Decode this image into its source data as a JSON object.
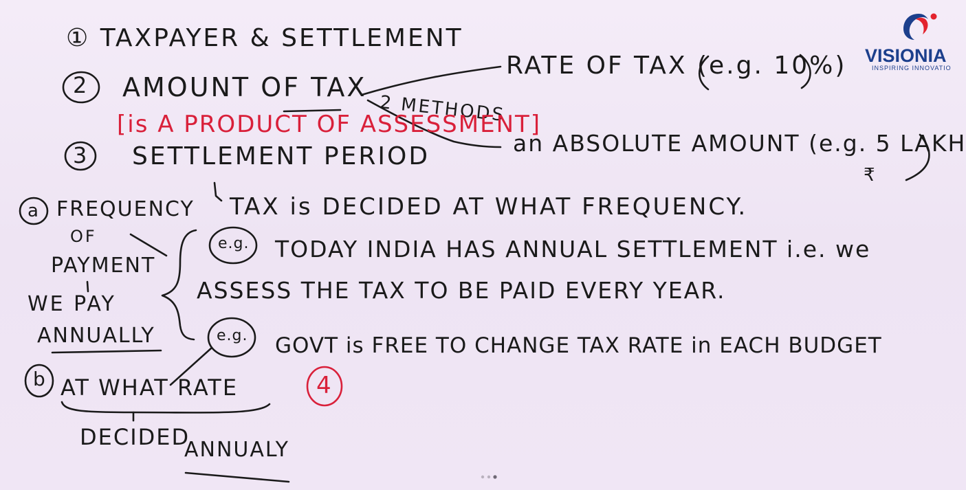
{
  "logo": {
    "name": "VISIONIA",
    "tagline": "INSPIRING INNOVATIO",
    "colors": {
      "brand_blue": "#1c3f8c",
      "brand_red": "#e3232e"
    }
  },
  "notes": {
    "line1": "① TAXPAYER & SETTLEMENT",
    "line2_num": "2",
    "line2": "AMOUNT OF TAX",
    "methods": "2 METHODS",
    "rate_of_tax": "RATE OF TAX (e.g. 10%)",
    "absolute_amount": "an ABSOLUTE AMOUNT (e.g. 5 LAKH",
    "rupee": "₹",
    "bracket_note": "[is A PRODUCT OF ASSESSMENT]",
    "line3_num": "3",
    "line3": "SETTLEMENT PERIOD",
    "tax_decided": "TAX is DECIDED AT WHAT FREQUENCY.",
    "eg_label": "e.g.",
    "today_india": "TODAY INDIA HAS ANNUAL SETTLEMENT i.e. we",
    "assess": "ASSESS THE TAX TO BE PAID EVERY YEAR.",
    "govt": "GOVT is FREE TO CHANGE TAX RATE in EACH BUDGET",
    "point_a_label": "a",
    "frequency": "FREQUENCY",
    "of": "OF",
    "payment": "PAYMENT",
    "we_pay": "WE PAY",
    "annually": "ANNUALLY",
    "point_b_label": "b",
    "at_what_rate": "AT WHAT RATE",
    "decided": "DECIDED",
    "annually2": "ANNUALY",
    "red_4": "4"
  },
  "colors": {
    "ink": "#1a1a1a",
    "red_ink": "#d9203a",
    "board": "#f1e9f6"
  }
}
